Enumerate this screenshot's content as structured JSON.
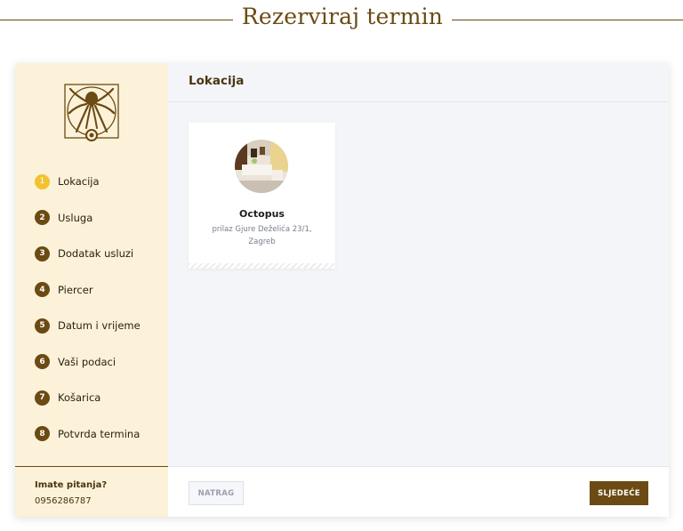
{
  "page": {
    "title": "Rezerviraj termin"
  },
  "sidebar": {
    "steps": [
      {
        "num": "1",
        "label": "Lokacija",
        "active": true
      },
      {
        "num": "2",
        "label": "Usluga"
      },
      {
        "num": "3",
        "label": "Dodatak usluzi"
      },
      {
        "num": "4",
        "label": "Piercer"
      },
      {
        "num": "5",
        "label": "Datum i vrijeme"
      },
      {
        "num": "6",
        "label": "Vaši podaci"
      },
      {
        "num": "7",
        "label": "Košarica"
      },
      {
        "num": "8",
        "label": "Potvrda termina"
      }
    ],
    "footer": {
      "question": "Imate pitanja?",
      "phone": "0956286787"
    }
  },
  "main": {
    "heading": "Lokacija",
    "locations": [
      {
        "name": "Octopus",
        "address": "prilaz Gjure Deželića 23/1, Zagreb"
      }
    ]
  },
  "footer": {
    "back_label": "NATRAG",
    "next_label": "SLJEDEĆE"
  },
  "colors": {
    "brand": "#6b4a13",
    "active_step": "#f2c230",
    "sidebar_bg": "#fbf2d9"
  },
  "icons": {
    "logo": "octopus-vitruvian-logo"
  }
}
